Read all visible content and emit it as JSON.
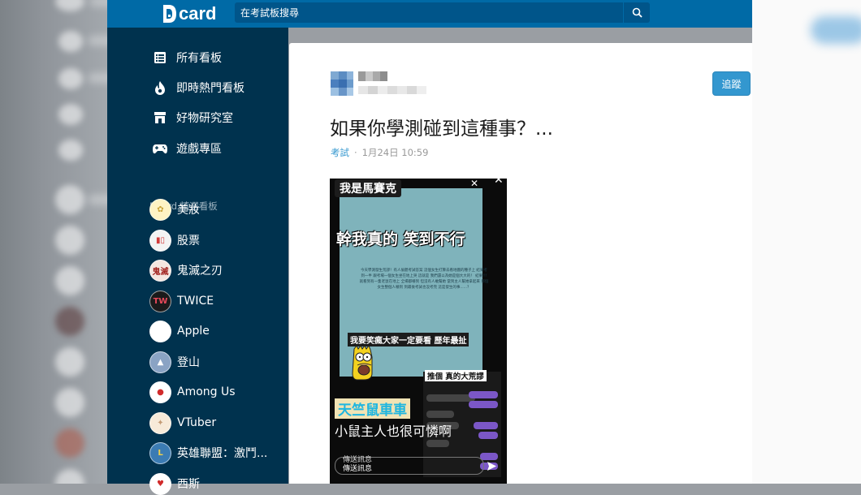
{
  "site": {
    "logo_text": "card"
  },
  "search": {
    "placeholder": "在考試板搜尋"
  },
  "nav": [
    {
      "label": "所有看板",
      "icon": "list-icon"
    },
    {
      "label": "即時熱門看板",
      "icon": "fire-icon"
    },
    {
      "label": "好物研究室",
      "icon": "store-icon"
    },
    {
      "label": "遊戲專區",
      "icon": "gamepad-icon"
    }
  ],
  "featured_section": "Dcard 精選看板",
  "boards": [
    {
      "label": "美妝",
      "avatar_bg": "#fff3c4",
      "avatar_text": "✿",
      "avatar_color": "#caa43a"
    },
    {
      "label": "股票",
      "avatar_bg": "#f3f3f3",
      "avatar_text": "▮▯",
      "avatar_color": "#d23b3b"
    },
    {
      "label": "鬼滅之刃",
      "avatar_bg": "#f4e6e0",
      "avatar_text": "鬼滅",
      "avatar_color": "#a1221f"
    },
    {
      "label": "TWICE",
      "avatar_bg": "#1b1b1b",
      "avatar_text": "TW",
      "avatar_color": "#e8495a"
    },
    {
      "label": "Apple",
      "avatar_bg": "#ffffff",
      "avatar_text": "",
      "avatar_color": "#8c8c8c"
    },
    {
      "label": "登山",
      "avatar_bg": "#8aa3c4",
      "avatar_text": "▲",
      "avatar_color": "#ffffff"
    },
    {
      "label": "Among Us",
      "avatar_bg": "#ffffff",
      "avatar_text": "●",
      "avatar_color": "#d12b2b"
    },
    {
      "label": "VTuber",
      "avatar_bg": "#f7ead9",
      "avatar_text": "✦",
      "avatar_color": "#c49b76"
    },
    {
      "label": "英雄聯盟：激鬥...",
      "avatar_bg": "#3b7bb3",
      "avatar_text": "L",
      "avatar_color": "#f0d04a"
    },
    {
      "label": "西斯",
      "avatar_bg": "#ffffff",
      "avatar_text": "♥",
      "avatar_color": "#d12b2b"
    }
  ],
  "post": {
    "follow_label": "追蹤",
    "title": "如果你學測碰到這種事？...",
    "forum": "考試",
    "timestamp": "1月24日 10:59",
    "image": {
      "label": "我是馬賽克",
      "headline": "幹我真的  笑到不行",
      "tiny_text": "今天學測發生荒謬！有人偷聽考試答案 這個女生打算去看地圖的種子上 結果考到一半 跟考場一個女生坐在地上哭 這就是 我們還以為她是個大大的！ 結果!!! 就看到有一隻老鼠在地上 全場都嚇到 但沒有人敢幫她 當到主人幫她拿起來 那個女生整個人嚇到 到最後考試也沒考完 這是發生的事......？",
      "caption": "我要笑瘋大家一定要看 歷年最扯",
      "chat_title": "推個 真的大荒謬",
      "yellow_text": "天竺鼠車車",
      "white_text": "小鼠主人也很可憐啊",
      "input_text": "傳送訊息",
      "input_text2": "傳送訊息"
    }
  },
  "colors": {
    "topbar": "#006aa6",
    "sidebar": "#00324e",
    "accent": "#3397cf"
  }
}
